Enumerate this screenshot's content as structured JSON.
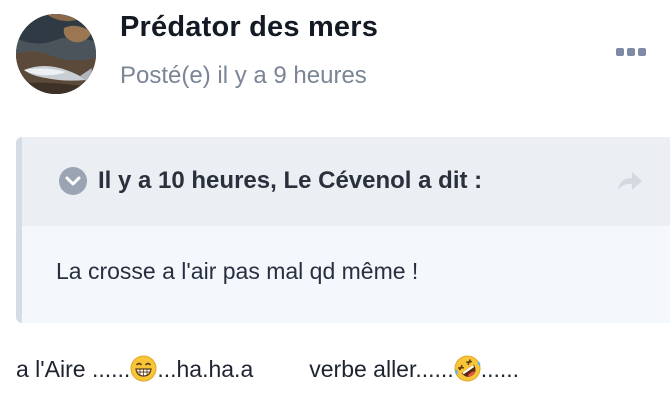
{
  "post": {
    "author": {
      "name": "Prédator des mers",
      "avatar_icon": "fish-on-rocks-avatar"
    },
    "posted": "Posté(e) il y a 9 heures",
    "more_icon": "ellipsis-icon",
    "quote": {
      "toggle_icon": "chevron-down-circle-icon",
      "citation": "Il y a 10 heures, Le Cévenol a dit :",
      "share_icon": "share-arrow-icon",
      "body": "La crosse a l'air pas mal qd même !"
    },
    "content": {
      "part1": "a l'Aire ......",
      "emoji1": "grinning-face-emoji",
      "part2": "...ha.ha.a",
      "part3": "verbe aller......",
      "emoji2": "rolling-on-floor-laughing-emoji",
      "part4": "......"
    }
  },
  "colors": {
    "author": "#141a24",
    "meta": "#7a8596",
    "quote_bg": "#f4f7fb",
    "quote_header_bg": "#ebeef3",
    "quote_border": "#d6dce5",
    "icon_gray": "#9aa4b2"
  }
}
